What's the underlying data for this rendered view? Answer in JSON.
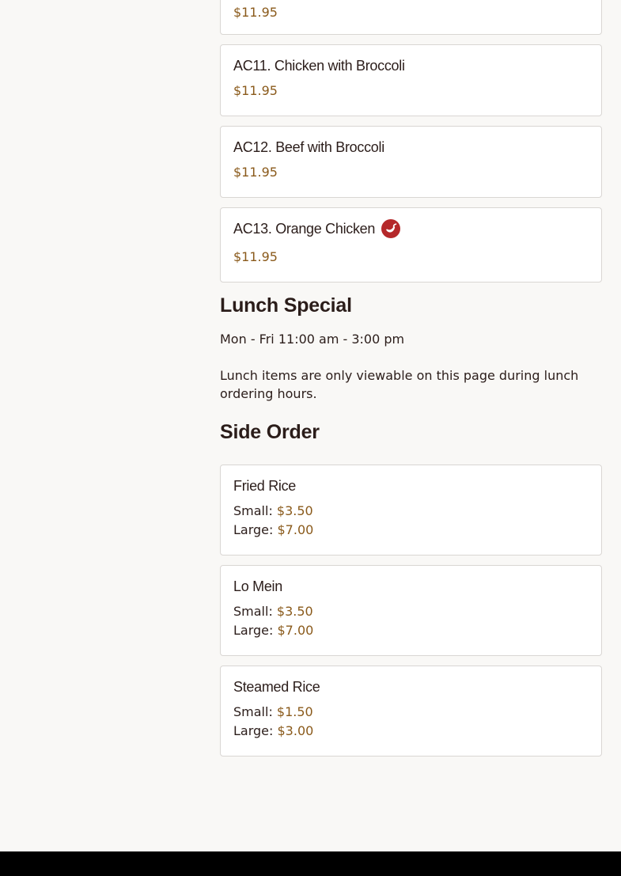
{
  "menu_items": [
    {
      "title": "",
      "price": "$11.95"
    },
    {
      "title": "AC11. Chicken with Broccoli",
      "price": "$11.95"
    },
    {
      "title": "AC12. Beef with Broccoli",
      "price": "$11.95"
    },
    {
      "title": "AC13. Orange Chicken",
      "price": "$11.95",
      "icon": "chili-pepper-icon"
    }
  ],
  "lunch_special": {
    "heading": "Lunch Special",
    "hours": "Mon - Fri 11:00 am - 3:00 pm",
    "note": "Lunch items are only viewable on this page during lunch ordering hours."
  },
  "side_order": {
    "heading": "Side Order",
    "items": [
      {
        "title": "Fried Rice",
        "small_label": "Small:",
        "small_price": "$3.50",
        "large_label": "Large:",
        "large_price": "$7.00"
      },
      {
        "title": "Lo Mein",
        "small_label": "Small:",
        "small_price": "$3.50",
        "large_label": "Large:",
        "large_price": "$7.00"
      },
      {
        "title": "Steamed Rice",
        "small_label": "Small:",
        "small_price": "$1.50",
        "large_label": "Large:",
        "large_price": "$3.00"
      }
    ]
  },
  "colors": {
    "background": "#f9f8f6",
    "price": "#8a5a1b",
    "text": "#2b1d1a",
    "spicy_icon": "#b5282a",
    "footer": "#000000"
  }
}
